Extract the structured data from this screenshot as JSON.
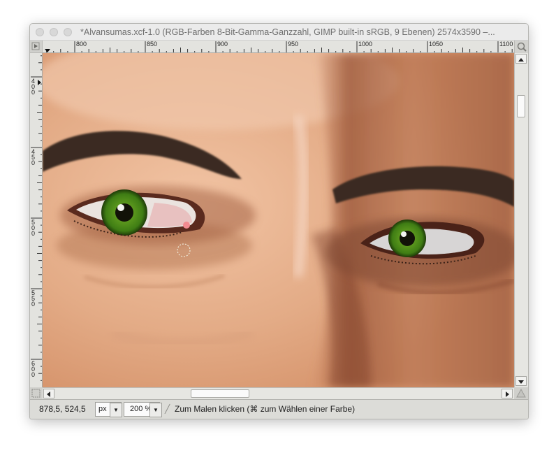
{
  "window": {
    "title": "*Alvansumas.xcf-1.0 (RGB-Farben 8-Bit-Gamma-Ganzzahl, GIMP built-in sRGB, 9 Ebenen) 2574x3590 –..."
  },
  "ruler": {
    "horizontal_labels": [
      "800",
      "850",
      "900",
      "950",
      "1000",
      "1050",
      "1100"
    ],
    "vertical_labels": [
      "400",
      "450",
      "500",
      "550",
      "600"
    ]
  },
  "statusbar": {
    "coordinates": "878,5, 524,5",
    "unit": "px",
    "zoom": "200 %",
    "message": "Zum Malen klicken (⌘ zum Wählen einer Farbe)"
  },
  "icons": {
    "quick_mask": "quick-mask-icon",
    "navigate": "navigate-icon",
    "zoom_to_window": "zoom-to-window-icon",
    "brush_cursor": "brush-outline-icon",
    "tool_hint": "pencil-icon"
  }
}
